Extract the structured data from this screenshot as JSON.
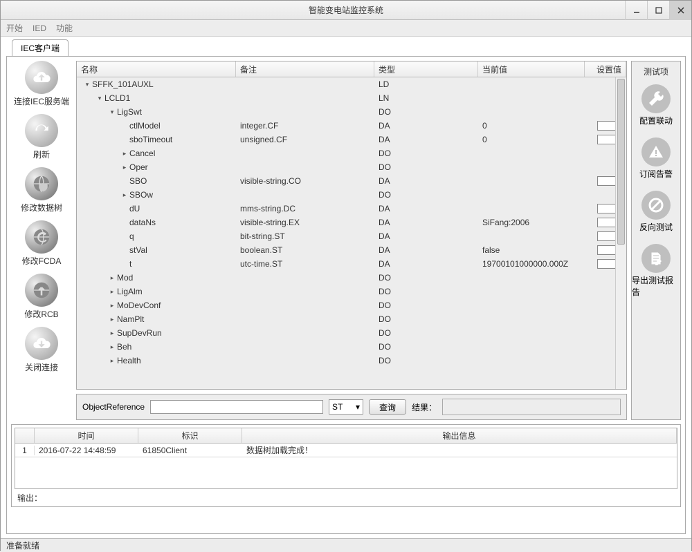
{
  "window": {
    "title": "智能变电站监控系统"
  },
  "menu": {
    "start": "开始",
    "ied": "IED",
    "function": "功能"
  },
  "tab": {
    "iec_client": "IEC客户端"
  },
  "leftbar": {
    "connect": "连接IEC服务端",
    "refresh": "刷新",
    "modify_tree": "修改数据树",
    "modify_fcda": "修改FCDA",
    "modify_rcb": "修改RCB",
    "close_conn": "关闭连接"
  },
  "rightbar": {
    "title": "测试项",
    "config_link": "配置联动",
    "sub_alarm": "订阅告警",
    "reverse_test": "反向测试",
    "export_report": "导出测试报告"
  },
  "grid": {
    "headers": {
      "name": "名称",
      "remark": "备注",
      "type": "类型",
      "curval": "当前值",
      "setval": "设置值"
    }
  },
  "rows": [
    {
      "indent": 0,
      "exp": "▾",
      "name": "SFFK_101AUXL",
      "remark": "",
      "type": "LD",
      "curval": "",
      "set": false
    },
    {
      "indent": 1,
      "exp": "▾",
      "name": "LCLD1",
      "remark": "",
      "type": "LN",
      "curval": "",
      "set": false
    },
    {
      "indent": 2,
      "exp": "▾",
      "name": "LigSwt",
      "remark": "",
      "type": "DO",
      "curval": "",
      "set": false
    },
    {
      "indent": 3,
      "exp": "",
      "name": "ctlModel",
      "remark": "integer.CF",
      "type": "DA",
      "curval": "0",
      "set": true
    },
    {
      "indent": 3,
      "exp": "",
      "name": "sboTimeout",
      "remark": "unsigned.CF",
      "type": "DA",
      "curval": "0",
      "set": true
    },
    {
      "indent": 3,
      "exp": "▸",
      "name": "Cancel",
      "remark": "",
      "type": "DO",
      "curval": "",
      "set": false
    },
    {
      "indent": 3,
      "exp": "▸",
      "name": "Oper",
      "remark": "",
      "type": "DO",
      "curval": "",
      "set": false
    },
    {
      "indent": 3,
      "exp": "",
      "name": "SBO",
      "remark": "visible-string.CO",
      "type": "DA",
      "curval": "",
      "set": true
    },
    {
      "indent": 3,
      "exp": "▸",
      "name": "SBOw",
      "remark": "",
      "type": "DO",
      "curval": "",
      "set": false
    },
    {
      "indent": 3,
      "exp": "",
      "name": "dU",
      "remark": "mms-string.DC",
      "type": "DA",
      "curval": "",
      "set": true
    },
    {
      "indent": 3,
      "exp": "",
      "name": "dataNs",
      "remark": "visible-string.EX",
      "type": "DA",
      "curval": "SiFang:2006",
      "set": true
    },
    {
      "indent": 3,
      "exp": "",
      "name": "q",
      "remark": "bit-string.ST",
      "type": "DA",
      "curval": "",
      "set": true
    },
    {
      "indent": 3,
      "exp": "",
      "name": "stVal",
      "remark": "boolean.ST",
      "type": "DA",
      "curval": "false",
      "set": true
    },
    {
      "indent": 3,
      "exp": "",
      "name": "t",
      "remark": "utc-time.ST",
      "type": "DA",
      "curval": "19700101000000.000Z",
      "set": true
    },
    {
      "indent": 2,
      "exp": "▸",
      "name": "Mod",
      "remark": "",
      "type": "DO",
      "curval": "",
      "set": false
    },
    {
      "indent": 2,
      "exp": "▸",
      "name": "LigAlm",
      "remark": "",
      "type": "DO",
      "curval": "",
      "set": false
    },
    {
      "indent": 2,
      "exp": "▸",
      "name": "MoDevConf",
      "remark": "",
      "type": "DO",
      "curval": "",
      "set": false
    },
    {
      "indent": 2,
      "exp": "▸",
      "name": "NamPlt",
      "remark": "",
      "type": "DO",
      "curval": "",
      "set": false
    },
    {
      "indent": 2,
      "exp": "▸",
      "name": "SupDevRun",
      "remark": "",
      "type": "DO",
      "curval": "",
      "set": false
    },
    {
      "indent": 2,
      "exp": "▸",
      "name": "Beh",
      "remark": "",
      "type": "DO",
      "curval": "",
      "set": false
    },
    {
      "indent": 2,
      "exp": "▸",
      "name": "Health",
      "remark": "",
      "type": "DO",
      "curval": "",
      "set": false
    }
  ],
  "query": {
    "label": "ObjectReference",
    "select_value": "ST",
    "button": "查询",
    "result_label": "结果："
  },
  "log": {
    "headers": {
      "time": "时间",
      "flag": "标识",
      "msg": "输出信息"
    },
    "row": {
      "idx": "1",
      "time": "2016-07-22 14:48:59",
      "flag": "61850Client",
      "msg": "数据树加载完成！"
    },
    "output_label": "输出："
  },
  "status": {
    "ready": "准备就绪"
  }
}
